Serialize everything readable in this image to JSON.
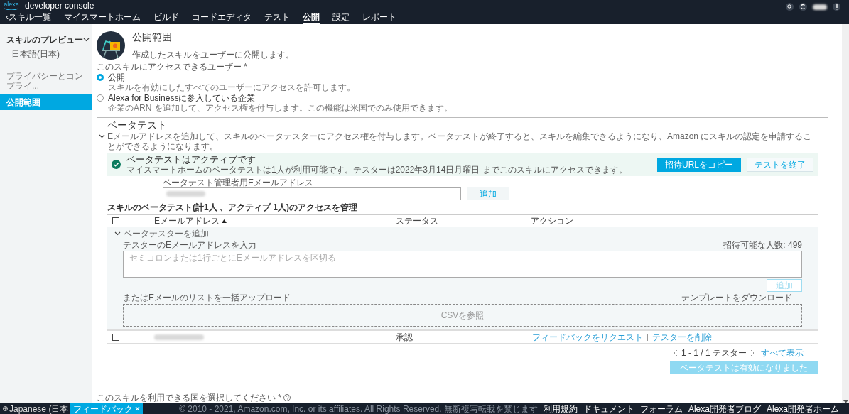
{
  "header": {
    "logo": "alexa",
    "title": "developer console",
    "nav": [
      {
        "label": "‹スキル一覧",
        "selected": false
      },
      {
        "label": "マイスマートホーム",
        "selected": false
      },
      {
        "label": "ビルド",
        "selected": false
      },
      {
        "label": "コードエディタ",
        "selected": false
      },
      {
        "label": "テスト",
        "selected": false
      },
      {
        "label": "公開",
        "selected": true
      },
      {
        "label": "設定",
        "selected": false
      },
      {
        "label": "レポート",
        "selected": false
      }
    ]
  },
  "sidebar": {
    "items": [
      {
        "kind": "group",
        "label": "スキルのプレビュー",
        "expanded": true,
        "selected": false,
        "children": [
          {
            "label": "日本語(日本)",
            "selected": false
          }
        ]
      },
      {
        "kind": "link",
        "label": "プライバシーとコンプライ...",
        "selected": false
      },
      {
        "kind": "link",
        "label": "公開範囲",
        "selected": true
      }
    ]
  },
  "page": {
    "title": "公開範囲",
    "subtitle": "作成したスキルをユーザーに公開します。"
  },
  "access": {
    "label": "このスキルにアクセスできるユーザー *",
    "options": [
      {
        "label": "公開",
        "description": "スキルを有効にしたすべてのユーザーにアクセスを許可します。",
        "selected": true
      },
      {
        "label": "Alexa for Businessに参入している企業",
        "description": "企業のARN を追加して、アクセス権を付与します。この機能は米国でのみ使用できます。",
        "selected": false
      }
    ]
  },
  "beta": {
    "title": "ベータテスト",
    "expanded": true,
    "description": "Eメールアドレスを追加して、スキルのベータテスターにアクセス権を付与します。ベータテストが終了すると、スキルを編集できるようになり、Amazon にスキルの認定を申請することができるようになります。",
    "banner": {
      "title": "ベータテストはアクティブです",
      "text": "マイスマートホームのベータテストは1人が利用可能です。テスターは2022年3月14日月曜日 までこのスキルにアクセスできます。",
      "buttons": [
        {
          "label": "招待URLをコピー",
          "kind": "primary"
        },
        {
          "label": "テストを終了",
          "kind": "secondary"
        }
      ]
    },
    "admin_email": {
      "label": "ベータテスト管理者用Eメールアドレス",
      "button": "追加"
    },
    "manage_heading": "スキルのベータテスト(計1人 、アクティブ 1人)のアクセスを管理",
    "table": {
      "select_all": {
        "checked": false
      },
      "columns": [
        {
          "label": "Eメールアドレス",
          "sorted": true
        },
        {
          "label": "ステータス",
          "sorted": false
        },
        {
          "label": "アクション",
          "sorted": false
        }
      ],
      "add_panel": {
        "title": "ベータテスターを追加",
        "expanded": true,
        "input_label": "テスターのEメールアドレスを入力",
        "remaining": "招待可能な人数: 499",
        "placeholder": "セミコロンまたは1行ごとにEメールアドレスを区切る",
        "button": "追加",
        "upload_label": "またはEメールのリストを一括アップロード",
        "template_link": "テンプレートをダウンロード",
        "dropzone": "CSVを参照"
      },
      "rows": [
        {
          "checked": false,
          "status": "承認",
          "actions": [
            "フィードバックをリクエスト",
            "テスターを削除"
          ]
        }
      ]
    },
    "pagination": {
      "range": "1 - 1 / 1 テスター",
      "show_all": "すべて表示"
    },
    "enable_button": {
      "label": "ベータテストは有効になりました",
      "disabled": true
    }
  },
  "country_question": "このスキルを利用できる国を選択してください *",
  "footer": {
    "language": "Japanese (日本",
    "feedback": "フィードバック",
    "copyright": "© 2010 - 2021, Amazon.com, Inc. or its affiliates. All Rights Reserved. 無断複写転載を禁じます",
    "links": [
      "利用規約",
      "ドキュメント",
      "フォーラム",
      "Alexa開発者ブログ",
      "Alexa開発者ホーム"
    ]
  }
}
